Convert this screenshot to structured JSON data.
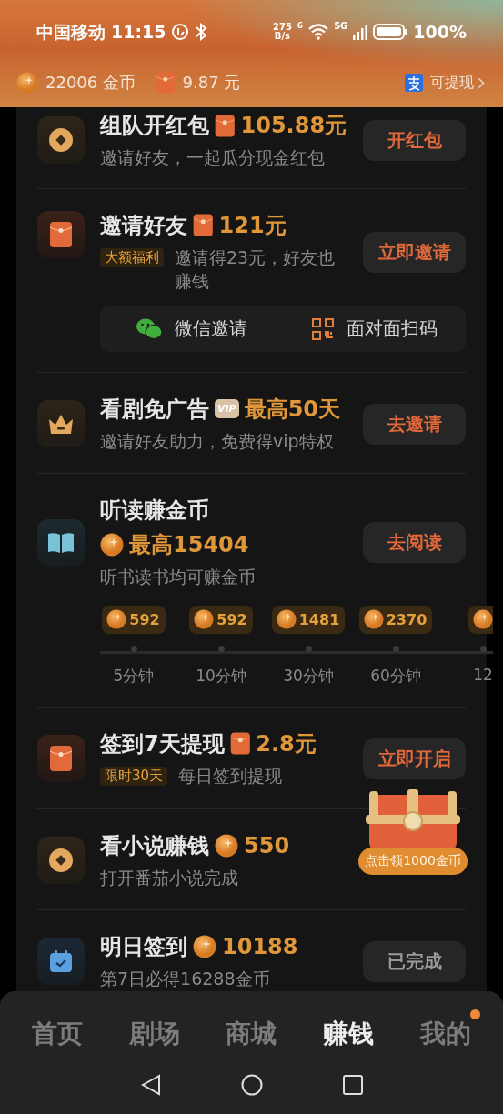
{
  "status_bar": {
    "carrier": "中国移动",
    "time": "11:15",
    "net_speed": [
      "275",
      "B/s"
    ],
    "wifi_badge": "6",
    "signal_badge": "5G",
    "battery": "100%"
  },
  "balance": {
    "coins": "22006 金币",
    "cash": "9.87 元",
    "withdraw": "可提现"
  },
  "tasks": [
    {
      "kind": "standard",
      "title": "组队开红包",
      "reward": {
        "kind": "redpacket",
        "amount": "105.88元"
      },
      "subtitle": "邀请好友，一起瓜分现金红包",
      "button": {
        "label": "开红包",
        "done": false
      }
    },
    {
      "kind": "invite",
      "title": "邀请好友",
      "reward": {
        "kind": "redpacket",
        "amount": "121元"
      },
      "tag": "大额福利",
      "subtitle": "邀请得23元，好友也赚钱",
      "button": {
        "label": "立即邀请",
        "done": false
      },
      "share_options": [
        "微信邀请",
        "面对面扫码"
      ]
    },
    {
      "kind": "standard",
      "title": "看剧免广告",
      "reward": {
        "kind": "vip",
        "badge": "VIP",
        "amount": "最高50天"
      },
      "subtitle": "邀请好友助力，免费得vip特权",
      "button": {
        "label": "去邀请",
        "done": false
      }
    },
    {
      "kind": "reading",
      "title": "听读赚金币",
      "reward": {
        "kind": "coin",
        "amount": "最高15404"
      },
      "subtitle": "听书读书均可赚金币",
      "button": {
        "label": "去阅读",
        "done": false
      },
      "milestones": [
        {
          "coins": "592",
          "time": "5分钟"
        },
        {
          "coins": "592",
          "time": "10分钟"
        },
        {
          "coins": "1481",
          "time": "30分钟"
        },
        {
          "coins": "2370",
          "time": "60分钟"
        },
        {
          "time": "12"
        }
      ]
    },
    {
      "kind": "standard",
      "title": "签到7天提现",
      "reward": {
        "kind": "redpacket",
        "amount": "2.8元"
      },
      "tag": "限时30天",
      "subtitle": "每日签到提现",
      "button": {
        "label": "立即开启",
        "done": false
      }
    },
    {
      "kind": "standard",
      "title": "看小说赚钱",
      "reward": {
        "kind": "coin",
        "amount": "550"
      },
      "subtitle": "打开番茄小说完成",
      "chest": {
        "label": "点击领1000金币"
      }
    },
    {
      "kind": "standard",
      "title": "明日签到",
      "reward": {
        "kind": "coin",
        "amount": "10188"
      },
      "subtitle": "第7日必得16288金币",
      "button": {
        "label": "已完成",
        "done": true
      }
    }
  ],
  "tabs": [
    {
      "label": "首页",
      "selected": false,
      "badge": false
    },
    {
      "label": "剧场",
      "selected": false,
      "badge": false
    },
    {
      "label": "商城",
      "selected": false,
      "badge": false
    },
    {
      "label": "赚钱",
      "selected": true,
      "badge": false
    },
    {
      "label": "我的",
      "selected": false,
      "badge": true
    }
  ]
}
